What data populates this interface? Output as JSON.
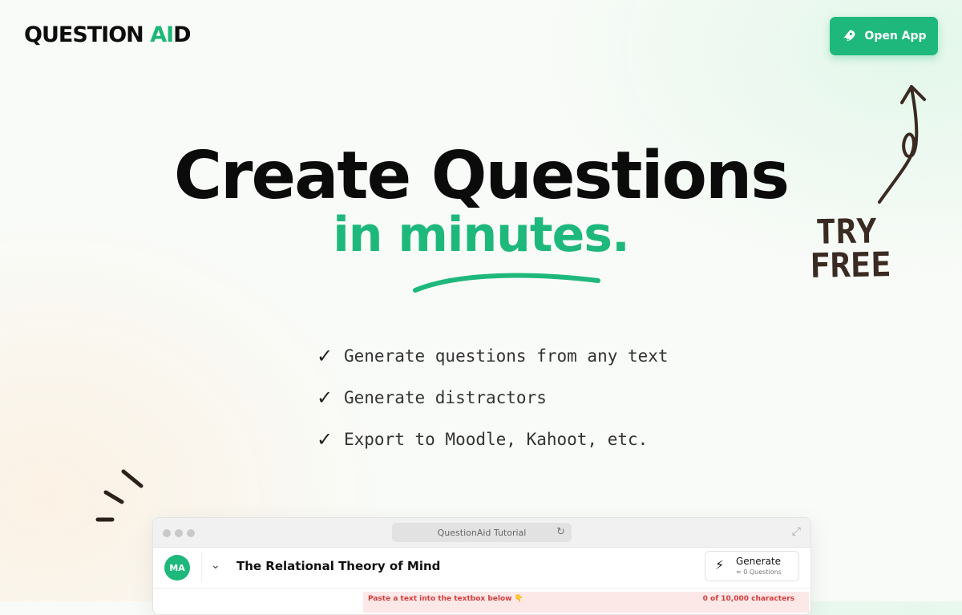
{
  "brand": {
    "logo_main": "QUESTION ",
    "logo_accent": "AI",
    "logo_tail": "D"
  },
  "header": {
    "open_app_label": "Open App",
    "accent_color": "#1fb87c"
  },
  "doodle": {
    "try_line1": "TRY",
    "try_line2": "FREE"
  },
  "hero": {
    "title": "Create Questions",
    "subtitle": "in minutes."
  },
  "features": [
    {
      "check": "✓",
      "text": "Generate questions from any text"
    },
    {
      "check": "✓",
      "text": "Generate distractors"
    },
    {
      "check": "✓",
      "text": "Export to Moodle, Kahoot, etc."
    }
  ],
  "preview": {
    "url_title": "QuestionAid Tutorial",
    "avatar_initials": "MA",
    "doc_title": "The Relational Theory of Mind",
    "generate_label": "Generate",
    "generate_sub": "≈ 0 Questions",
    "hint": "Paste a text into the textbox below 👇",
    "char_count": "0 of 10,000 characters"
  }
}
